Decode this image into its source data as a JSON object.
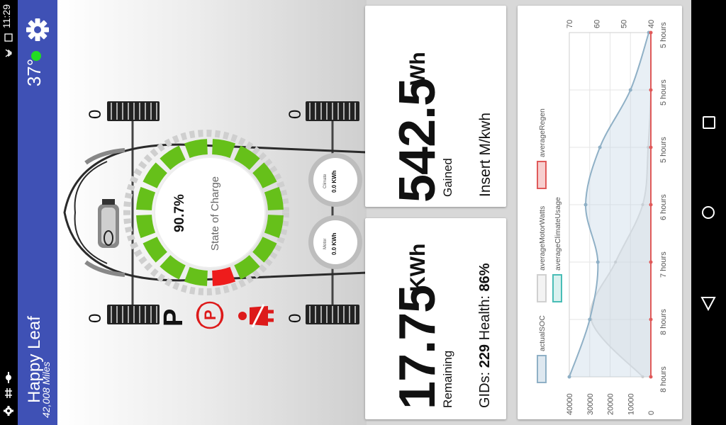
{
  "status_bar": {
    "time": "11:29"
  },
  "app_bar": {
    "title": "Happy Leaf",
    "odometer": "42,008 Miles",
    "temperature": "37°"
  },
  "gauge": {
    "soc_percent": "90.7%",
    "soc_label": "State of Charge",
    "soc_value": 0.907,
    "gear": "P",
    "climate_label": "Climate",
    "climate_value": "0.0 KWh",
    "motor_label": "Motor",
    "motor_value": "0.0 KWh",
    "tire_front_left": "0",
    "tire_front_right": "0",
    "tire_rear_left": "0",
    "tire_rear_right": "0"
  },
  "energy_gained": {
    "value": "542.5",
    "unit": "Wh",
    "label": "Gained",
    "efficiency": "Insert M/kwh"
  },
  "energy_remaining": {
    "value": "17.75",
    "unit": "KWh",
    "label": "Remaining",
    "gids_label": "GIDs:",
    "gids": "229",
    "health_label": "Health:",
    "health": "86%"
  },
  "colors": {
    "accent": "#3f51b5",
    "soc_green": "#66c01a",
    "soc_red": "#ee1c1c",
    "warning_red": "#dd1a1a",
    "status_green": "#22dd22",
    "series_soc": "#8fb0c6",
    "series_regen": "#e05a5a",
    "series_climate": "#49bdb6"
  },
  "chart_data": {
    "type": "line",
    "x": [
      "8 hours",
      "8 hours",
      "7 hours",
      "6 hours",
      "5 hours",
      "5 hours",
      "5 hours"
    ],
    "series": [
      {
        "name": "actualSOC",
        "values": [
          40000,
          30000,
          26000,
          32000,
          25000,
          10000,
          1000
        ]
      },
      {
        "name": "averageMotorWatts",
        "values": [
          43,
          62,
          53,
          43,
          41,
          40,
          40
        ]
      },
      {
        "name": "averageRegen",
        "values": [
          40,
          40,
          40,
          40,
          40,
          40,
          40
        ]
      },
      {
        "name": "averageClimateUsage",
        "values": []
      }
    ],
    "left_axis_ticks": [
      "40000",
      "30000",
      "20000",
      "10000",
      "0"
    ],
    "right_axis_ticks": [
      "70",
      "60",
      "50",
      "40"
    ],
    "ylim_left": [
      0,
      40000
    ],
    "ylim_right": [
      40,
      70
    ]
  }
}
